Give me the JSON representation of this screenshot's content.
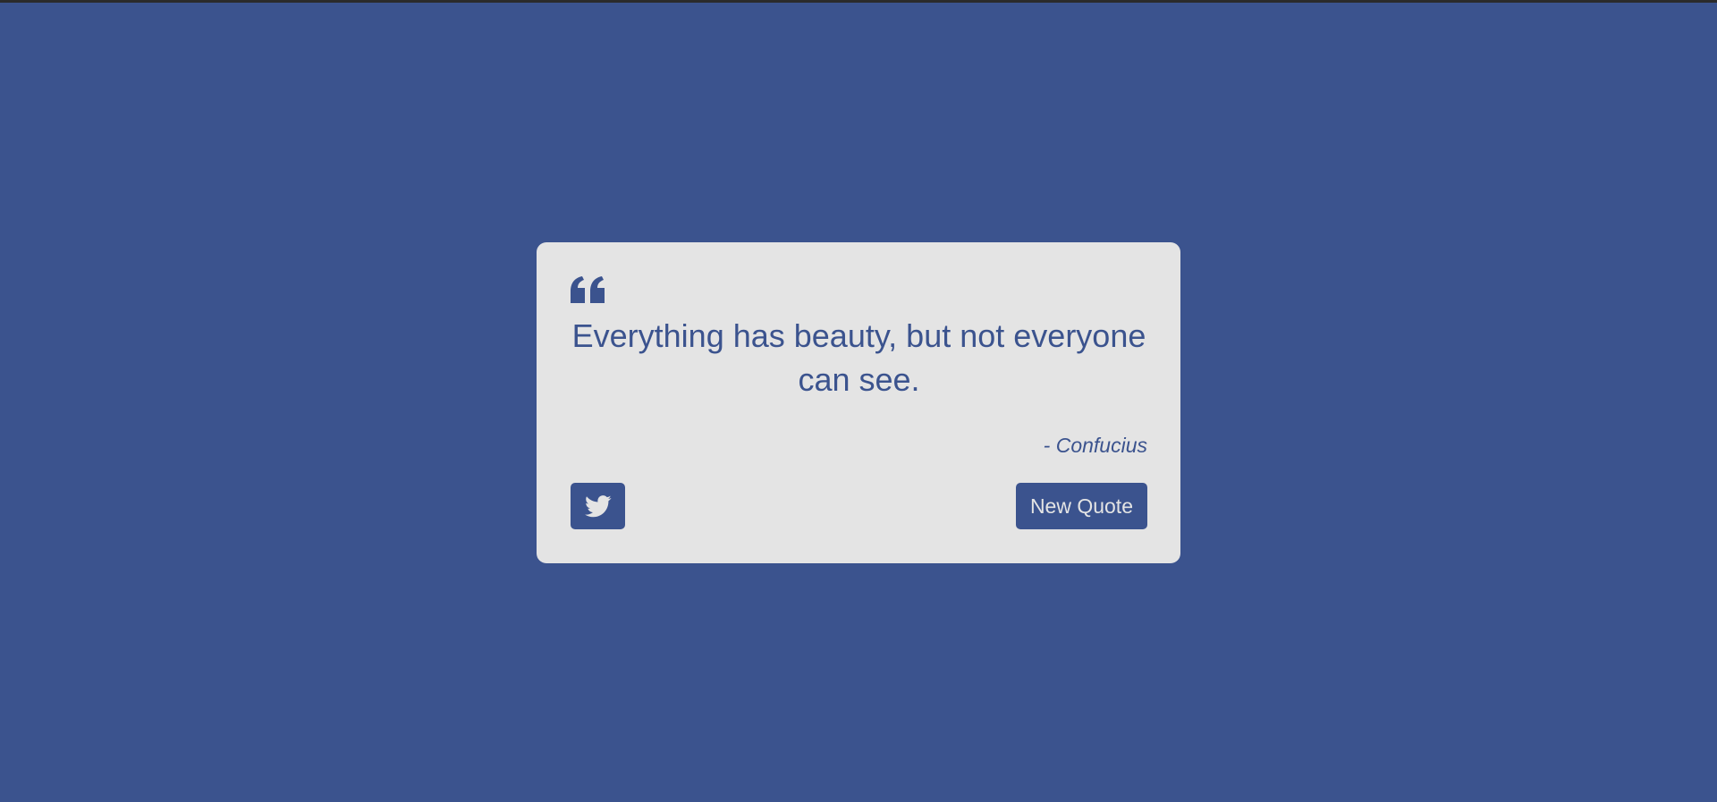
{
  "colors": {
    "background": "#3b538e",
    "card": "#e4e4e4",
    "accent": "#3b538e",
    "button_text": "#e4e4e4"
  },
  "quote_box": {
    "icon": "quote-left-icon",
    "text": "Everything has beauty, but not everyone can see.",
    "author": "- Confucius",
    "tweet_icon": "twitter-icon",
    "new_quote_label": "New Quote"
  }
}
